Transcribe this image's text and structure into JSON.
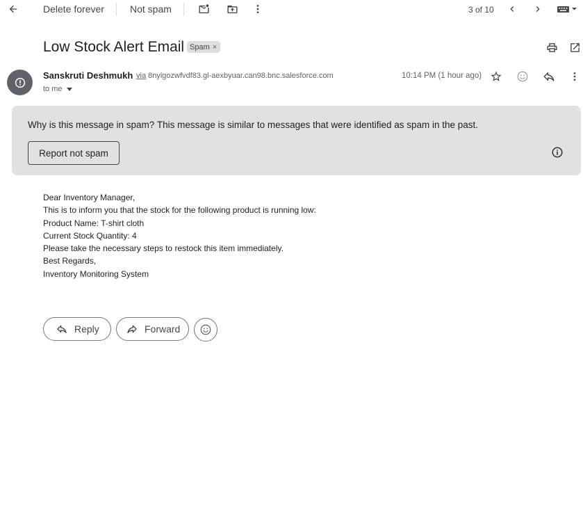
{
  "toolbar": {
    "delete_forever": "Delete forever",
    "not_spam": "Not spam",
    "counter": "3 of 10"
  },
  "message": {
    "subject": "Low Stock Alert Email",
    "label": "Spam",
    "label_close": "×",
    "sender_name": "Sanskruti Deshmukh",
    "via_word": "via",
    "via_domain": "8nyigozwfvdf83.gl-aexbyuar.can98.bnc.salesforce.com",
    "to_me": "to me",
    "timestamp": "10:14 PM (1 hour ago)"
  },
  "spam_warning": {
    "question": "Why is this message in spam?",
    "explanation": "This message is similar to messages that were identified as spam in the past.",
    "report_button": "Report not spam"
  },
  "body_lines": [
    "Dear Inventory Manager,",
    "This is to inform you that the stock for the following product is running low:",
    "Product Name: T-shirt cloth",
    "Current Stock Quantity: 4",
    "Please take the necessary steps to restock this item immediately.",
    "Best Regards,",
    "Inventory Monitoring System"
  ],
  "actions": {
    "reply": "Reply",
    "forward": "Forward"
  },
  "icons": [
    "back-arrow-icon",
    "mark-unread-icon",
    "move-to-icon",
    "more-vert-icon",
    "chevron-left-icon",
    "chevron-right-icon",
    "keyboard-icon",
    "print-icon",
    "open-new-window-icon",
    "spam-alert-icon",
    "star-icon",
    "emoji-icon",
    "reply-icon",
    "info-icon",
    "forward-icon"
  ],
  "colors": {
    "warning_bg": "#e1e1e1",
    "avatar_bg": "#5f6368",
    "text_primary": "#1f1f1f",
    "text_secondary": "#5f6368"
  }
}
